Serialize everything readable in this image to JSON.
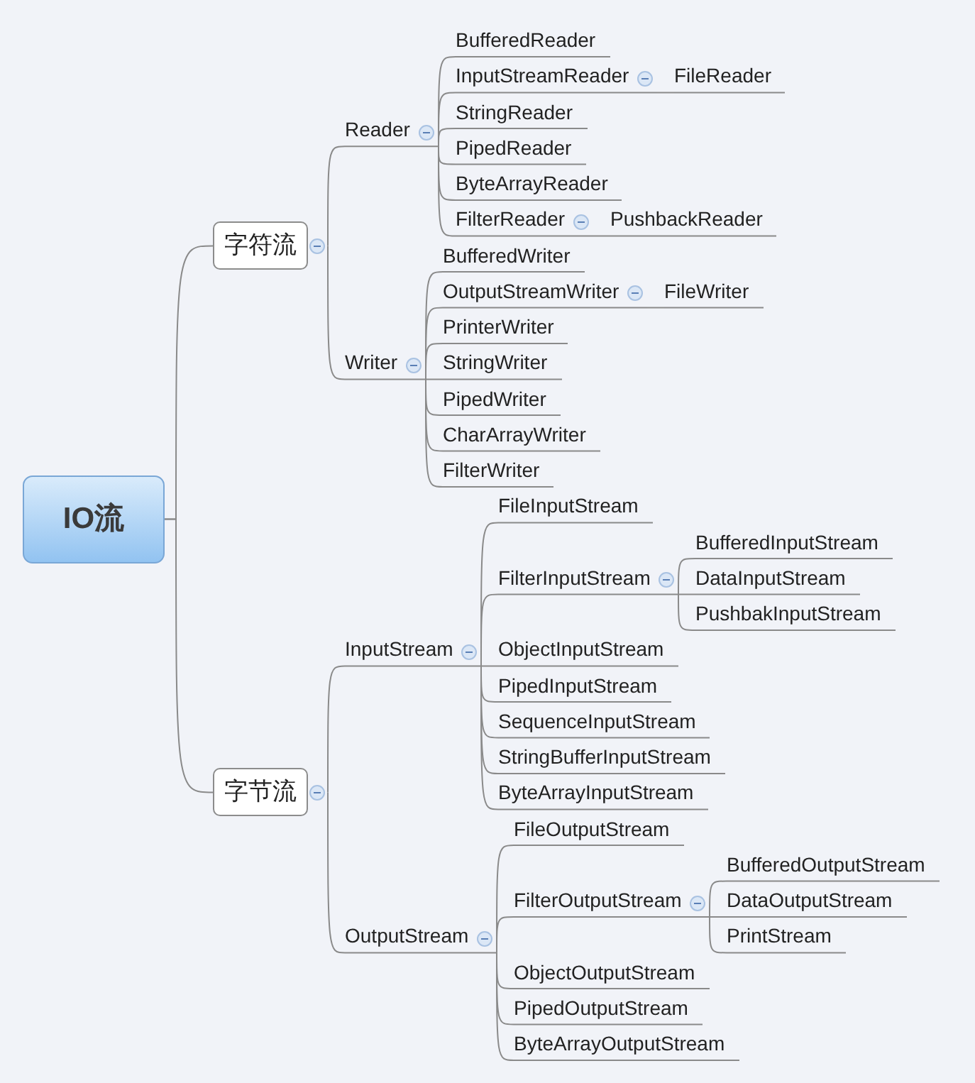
{
  "mind_map": {
    "root": {
      "label": "IO流",
      "children": [
        {
          "label": "字符流",
          "expanded": true,
          "children": [
            {
              "label": "Reader",
              "expanded": true,
              "children": [
                {
                  "label": "BufferedReader"
                },
                {
                  "label": "InputStreamReader",
                  "expanded": true,
                  "children": [
                    {
                      "label": "FileReader"
                    }
                  ]
                },
                {
                  "label": "StringReader"
                },
                {
                  "label": "PipedReader"
                },
                {
                  "label": "ByteArrayReader"
                },
                {
                  "label": "FilterReader",
                  "expanded": true,
                  "children": [
                    {
                      "label": "PushbackReader"
                    }
                  ]
                }
              ]
            },
            {
              "label": "Writer",
              "expanded": true,
              "children": [
                {
                  "label": "BufferedWriter"
                },
                {
                  "label": "OutputStreamWriter",
                  "expanded": true,
                  "children": [
                    {
                      "label": "FileWriter"
                    }
                  ]
                },
                {
                  "label": "PrinterWriter"
                },
                {
                  "label": "StringWriter"
                },
                {
                  "label": "PipedWriter"
                },
                {
                  "label": "CharArrayWriter"
                },
                {
                  "label": "FilterWriter"
                }
              ]
            }
          ]
        },
        {
          "label": "字节流",
          "expanded": true,
          "children": [
            {
              "label": "InputStream",
              "expanded": true,
              "children": [
                {
                  "label": "FileInputStream"
                },
                {
                  "label": "FilterInputStream",
                  "expanded": true,
                  "children": [
                    {
                      "label": "BufferedInputStream"
                    },
                    {
                      "label": "DataInputStream"
                    },
                    {
                      "label": "PushbakInputStream"
                    }
                  ]
                },
                {
                  "label": "ObjectInputStream"
                },
                {
                  "label": "PipedInputStream"
                },
                {
                  "label": "SequenceInputStream"
                },
                {
                  "label": "StringBufferInputStream"
                },
                {
                  "label": "ByteArrayInputStream"
                }
              ]
            },
            {
              "label": "OutputStream",
              "expanded": true,
              "children": [
                {
                  "label": "FileOutputStream"
                },
                {
                  "label": "FilterOutputStream",
                  "expanded": true,
                  "children": [
                    {
                      "label": "BufferedOutputStream"
                    },
                    {
                      "label": "DataOutputStream"
                    },
                    {
                      "label": "PrintStream"
                    }
                  ]
                },
                {
                  "label": "ObjectOutputStream"
                },
                {
                  "label": "PipedOutputStream"
                },
                {
                  "label": "ByteArrayOutputStream"
                }
              ]
            }
          ]
        }
      ]
    }
  }
}
